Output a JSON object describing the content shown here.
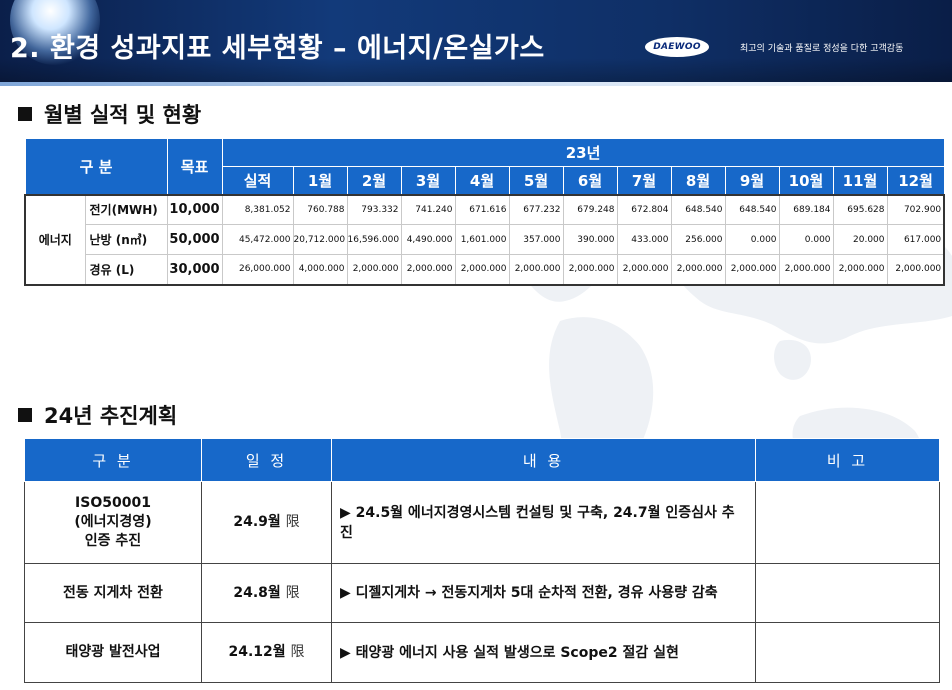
{
  "header": {
    "title": "2. 환경 성과지표 세부현황 – 에너지/온실가스",
    "logo_text": "DAEWOO",
    "tagline": "최고의 기술과 품질로  정성을 다한 고객감동",
    "colors": {
      "primary": "#123a7a",
      "table_header": "#1768c9"
    }
  },
  "section1": {
    "heading": "월별 실적 및 현황",
    "table": {
      "category_header": "구 분",
      "goal_header": "목표",
      "year_header": "23년",
      "actual_header": "실적",
      "month_headers": [
        "1월",
        "2월",
        "3월",
        "4월",
        "5월",
        "6월",
        "7월",
        "8월",
        "9월",
        "10월",
        "11월",
        "12월"
      ],
      "group_label": "에너지",
      "rows": [
        {
          "label": "전기(MWH)",
          "goal": "10,000",
          "actual": "8,381.052",
          "months": [
            "760.788",
            "793.332",
            "741.240",
            "671.616",
            "677.232",
            "679.248",
            "672.804",
            "648.540",
            "648.540",
            "689.184",
            "695.628",
            "702.900"
          ]
        },
        {
          "label": "난방 (n㎥)",
          "goal": "50,000",
          "actual": "45,472.000",
          "months": [
            "20,712.000",
            "16,596.000",
            "4,490.000",
            "1,601.000",
            "357.000",
            "390.000",
            "433.000",
            "256.000",
            "0.000",
            "0.000",
            "20.000",
            "617.000"
          ]
        },
        {
          "label": "경유 (L)",
          "goal": "30,000",
          "actual": "26,000.000",
          "months": [
            "4,000.000",
            "2,000.000",
            "2,000.000",
            "2,000.000",
            "2,000.000",
            "2,000.000",
            "2,000.000",
            "2,000.000",
            "2,000.000",
            "2,000.000",
            "2,000.000",
            "2,000.000"
          ]
        }
      ]
    }
  },
  "section2": {
    "heading": "24년 추진계획",
    "table": {
      "headers": [
        "구 분",
        "일 정",
        "내 용",
        "비 고"
      ],
      "rows": [
        {
          "category": [
            "ISO50001",
            "(에너지경영)",
            "인증 추진"
          ],
          "schedule": "24.9월",
          "schedule_suffix": "限",
          "content": "▶ 24.5월 에너지경영시스템 컨설팅 및 구축, 24.7월 인증심사 추진",
          "note": ""
        },
        {
          "category": [
            "전동 지게차 전환"
          ],
          "schedule": "24.8월",
          "schedule_suffix": "限",
          "content": "▶ 디젤지게차 → 전동지게차 5대 순차적 전환, 경유 사용량 감축",
          "note": ""
        },
        {
          "category": [
            "태양광 발전사업"
          ],
          "schedule": "24.12월",
          "schedule_suffix": "限",
          "content": "▶ 태양광 에너지 사용 실적 발생으로 Scope2 절감 실현",
          "note": ""
        }
      ]
    }
  }
}
